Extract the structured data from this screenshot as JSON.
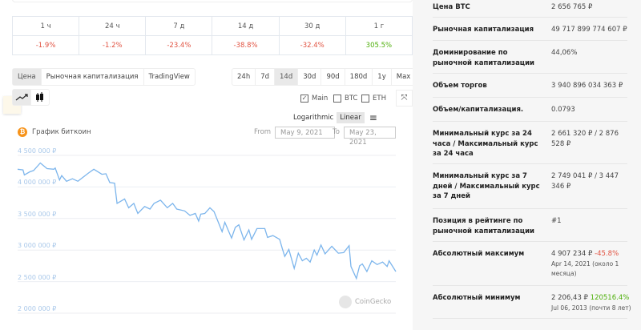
{
  "change_table": {
    "periods": [
      "1 ч",
      "24 ч",
      "7 д",
      "14 д",
      "30 д",
      "1 г"
    ],
    "values": [
      "-1.9%",
      "-1.2%",
      "-23.4%",
      "-38.8%",
      "-32.4%",
      "305.5%"
    ],
    "signs": [
      "neg",
      "neg",
      "neg",
      "neg",
      "neg",
      "pos"
    ]
  },
  "view_tabs": [
    "Цена",
    "Рыночная капитализация",
    "TradingView"
  ],
  "ranges": [
    "24h",
    "7d",
    "14d",
    "30d",
    "90d",
    "180d",
    "1y",
    "Max"
  ],
  "compare": {
    "main": "Main",
    "btc": "BTC",
    "eth": "ETH"
  },
  "scale": {
    "log": "Logarithmic",
    "linear": "Linear"
  },
  "chart_title": "График биткоин",
  "date_range": {
    "from_label": "From",
    "from": "May 9, 2021",
    "to_label": "To",
    "to": "May 23, 2021"
  },
  "watermark": "CoinGecko",
  "colors": {
    "line": "#7cb5ec",
    "negative": "#e15241",
    "positive": "#4eaf0a"
  },
  "chart_data": {
    "type": "line",
    "title": "График биткоин",
    "xlabel": "",
    "ylabel": "",
    "ylim": [
      2000000,
      4500000
    ],
    "yticks": [
      "4 500 000 ₽",
      "4 000 000 ₽",
      "3 500 000 ₽",
      "3 000 000 ₽",
      "2 500 000 ₽",
      "2 000 000 ₽"
    ],
    "ytick_values": [
      4500000,
      4000000,
      3500000,
      3000000,
      2500000,
      2000000
    ],
    "xlim_days": [
      0,
      14
    ],
    "series": [
      {
        "name": "Main",
        "day": [
          0,
          0.2,
          0.25,
          0.45,
          0.59,
          0.84,
          1.09,
          1.34,
          1.39,
          1.55,
          1.63,
          1.81,
          2.03,
          2.23,
          2.62,
          2.82,
          3.12,
          3.27,
          3.41,
          3.59,
          3.68,
          3.96,
          4.11,
          4.3,
          4.45,
          4.7,
          4.9,
          5.05,
          5.29,
          5.54,
          5.74,
          5.89,
          6.18,
          6.38,
          6.58,
          6.7,
          6.78,
          6.93,
          7.12,
          7.27,
          7.57,
          7.67,
          7.92,
          8.06,
          8.19,
          8.38,
          8.56,
          8.66,
          8.86,
          9.15,
          9.25,
          9.45,
          9.7,
          9.8,
          9.89,
          10.04,
          10.24,
          10.39,
          10.54,
          10.69,
          10.83,
          10.98,
          11.08,
          11.23,
          11.38,
          11.63,
          11.87,
          12.07,
          12.27,
          12.34,
          12.54,
          12.66,
          12.76,
          12.93,
          13.11,
          13.31,
          13.51,
          13.68,
          13.75,
          14
        ],
        "values": [
          4280000,
          4270000,
          4190000,
          4240000,
          4260000,
          4380000,
          4290000,
          4280000,
          4300000,
          4110000,
          4180000,
          4090000,
          4130000,
          4090000,
          4220000,
          4280000,
          4200000,
          4210000,
          4070000,
          4060000,
          3740000,
          3810000,
          3670000,
          3740000,
          3580000,
          3690000,
          3650000,
          3740000,
          3790000,
          3670000,
          3740000,
          3650000,
          3620000,
          3550000,
          3580000,
          3460000,
          3570000,
          3580000,
          3670000,
          3610000,
          3290000,
          3440000,
          3190000,
          3360000,
          3400000,
          3160000,
          3320000,
          3170000,
          3340000,
          3340000,
          3200000,
          3230000,
          3170000,
          3020000,
          2900000,
          3010000,
          2710000,
          2950000,
          2830000,
          2870000,
          2810000,
          3000000,
          2920000,
          3080000,
          2940000,
          3060000,
          2950000,
          2960000,
          3070000,
          2740000,
          2550000,
          2750000,
          2780000,
          2660000,
          2830000,
          2770000,
          2810000,
          2740000,
          2830000,
          2660000
        ]
      }
    ]
  },
  "stats": [
    {
      "k": "Цена BTC",
      "v": "2 656 765 ₽"
    },
    {
      "k": "Рыночная капитализация",
      "v": "49 717 899 774 607 ₽"
    },
    {
      "k": "Доминирование по рыночной капитализации",
      "v": "44,06%"
    },
    {
      "k": "Объем торгов",
      "v": "3 940 896 034 363 ₽"
    },
    {
      "k": "Объем/капитализация.",
      "v": "0.0793"
    },
    {
      "k": "Минимальный курс за 24 часа / Максимальный курс за 24 часа",
      "v": "2 661 320 ₽ / 2 876 528 ₽"
    },
    {
      "k": "Минимальный курс за 7 дней / Максимальный курс за 7 дней",
      "v": "2 749 041 ₽ / 3 447 346 ₽"
    },
    {
      "k": "Позиция в рейтинге по рыночной капитализации",
      "v": "#1"
    },
    {
      "k": "Абсолютный максимум",
      "v": "4 907 234 ₽",
      "pct": "-45.8%",
      "sub": "Apr 14, 2021 (около 1 месяца)"
    },
    {
      "k": "Абсолютный минимум",
      "v": "2 206,43 ₽",
      "pct": "120516.4%",
      "sub": "Jul 06, 2013 (почти 8 лет)"
    }
  ]
}
